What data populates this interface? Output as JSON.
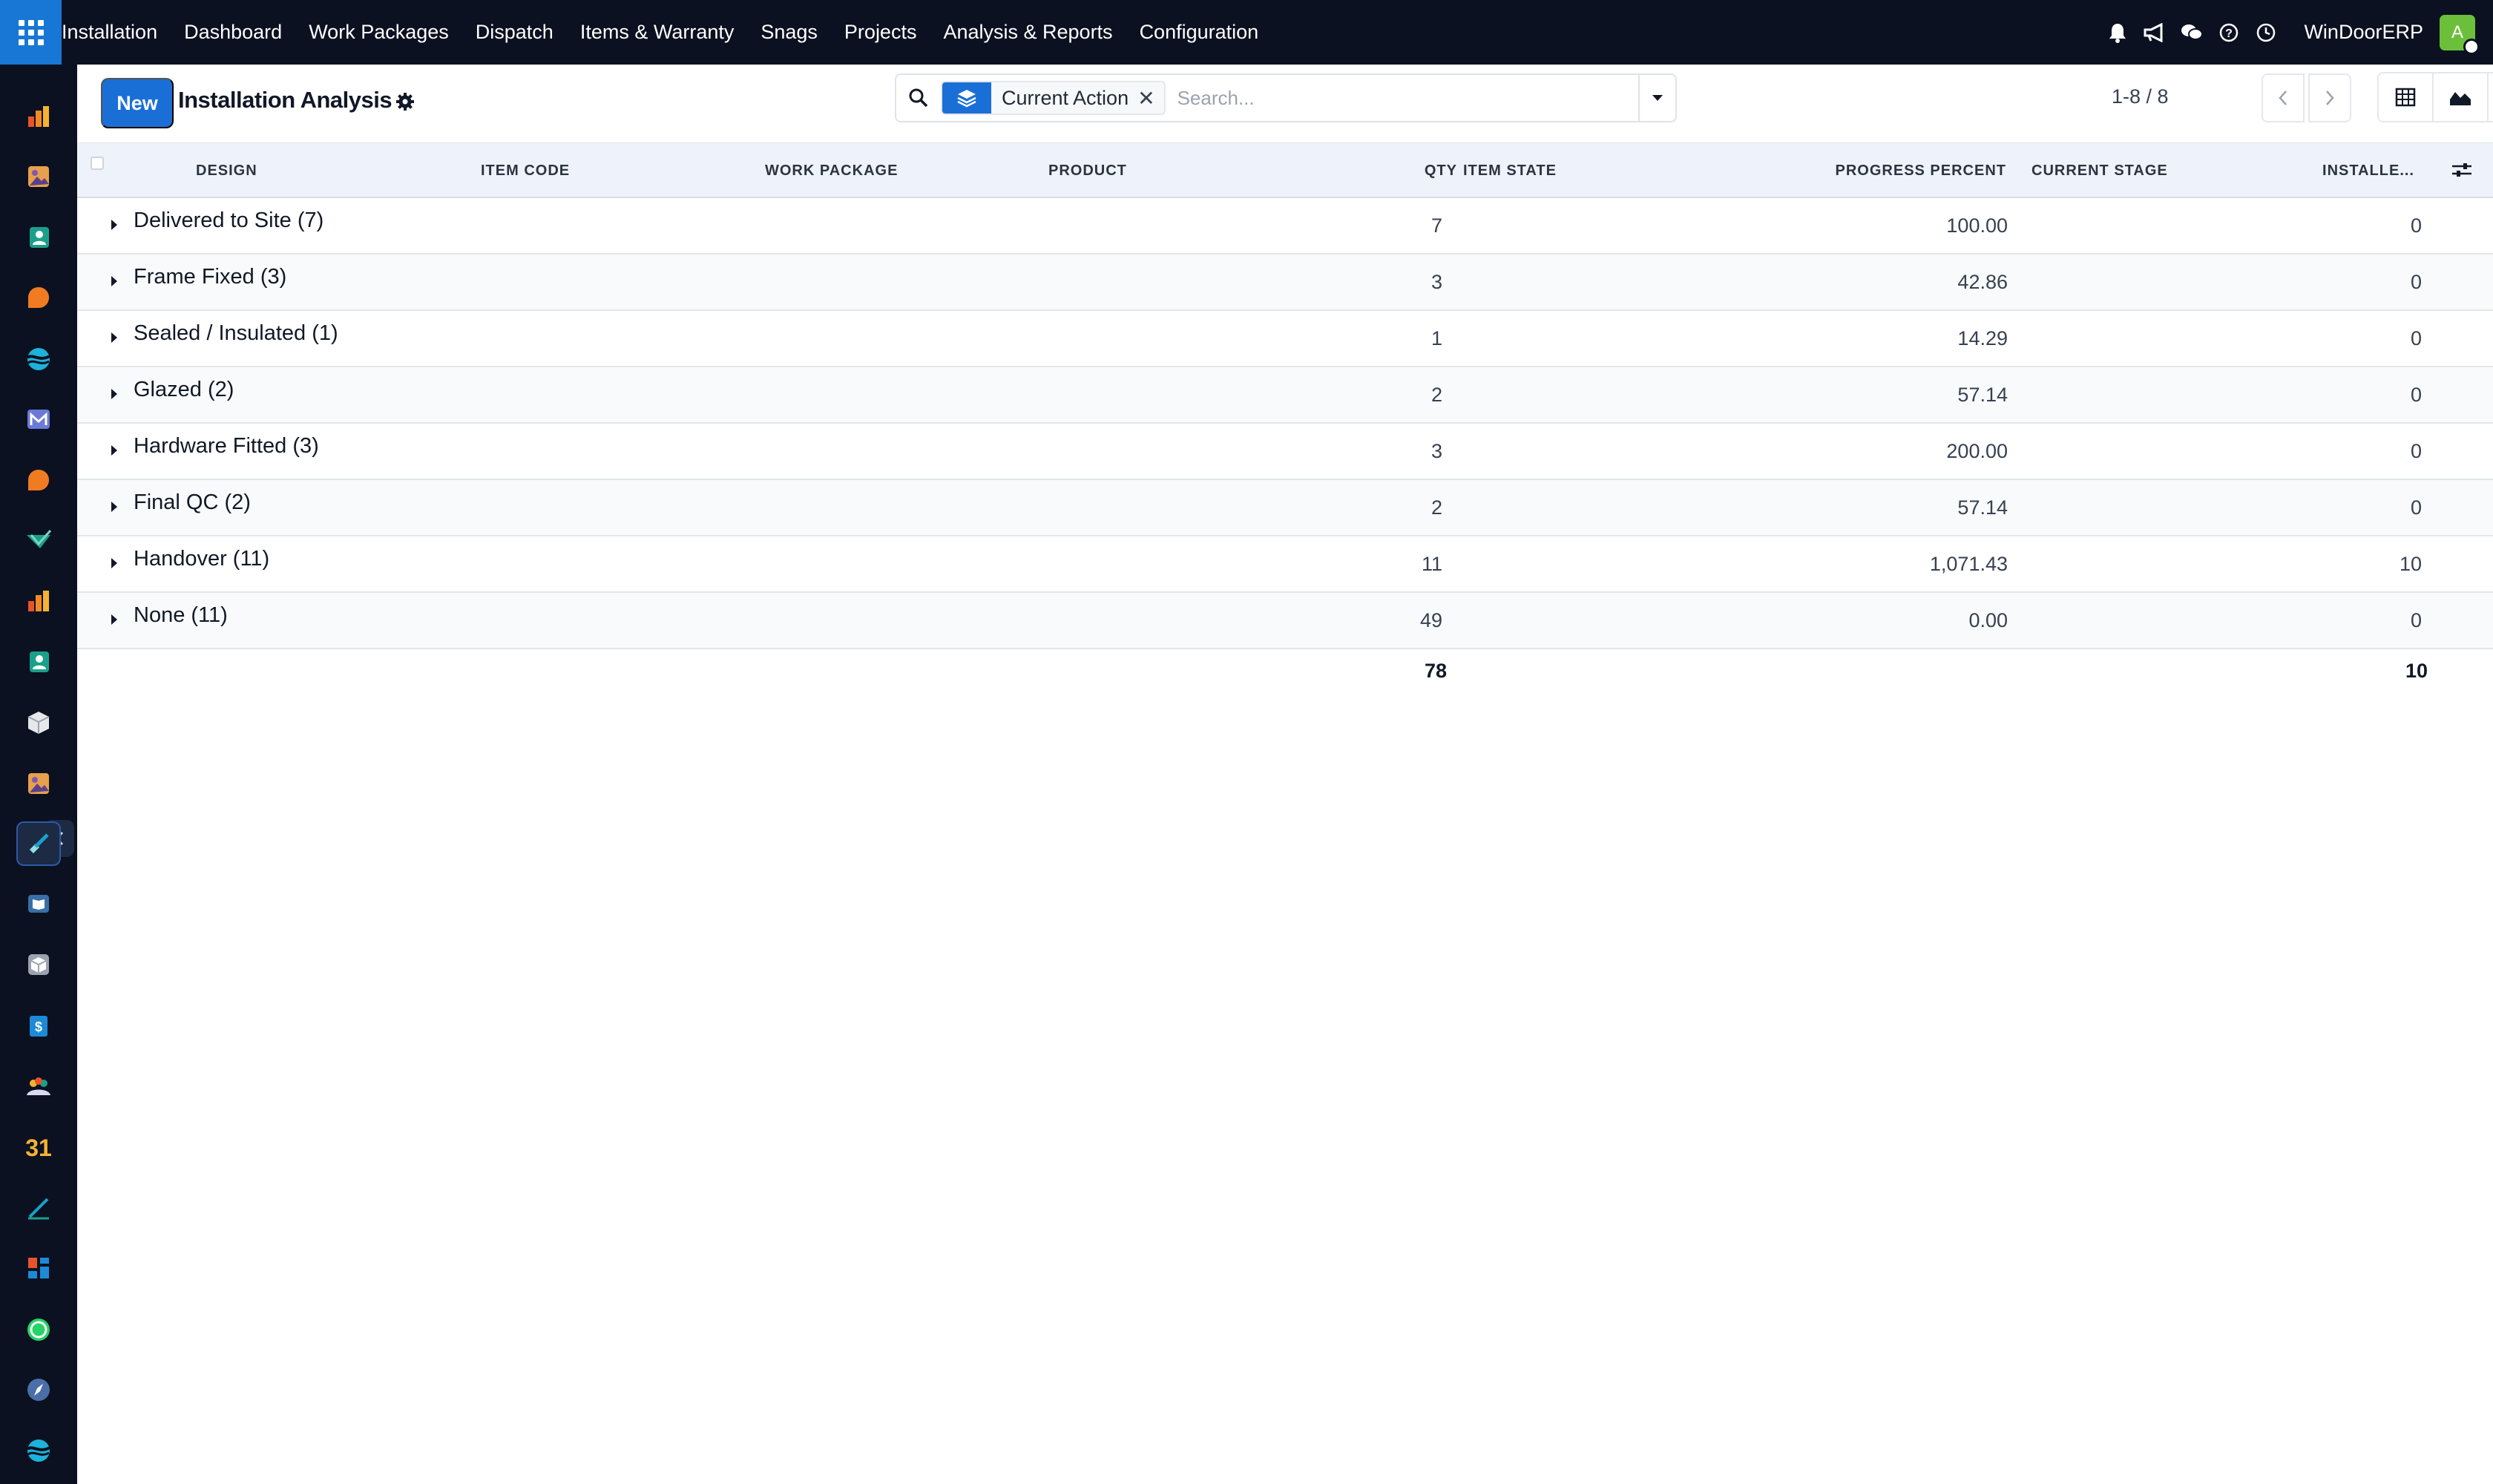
{
  "topbar": {
    "menu": [
      "Installation",
      "Dashboard",
      "Work Packages",
      "Dispatch",
      "Items & Warranty",
      "Snags",
      "Projects",
      "Analysis & Reports",
      "Configuration"
    ],
    "icons": [
      "bell-icon",
      "megaphone-icon",
      "chat-icon",
      "help-icon",
      "clock-icon"
    ],
    "brand": "WinDoorERP",
    "avatar_initial": "A"
  },
  "sidebar": {
    "apps": [
      "chart-bar-app-icon",
      "photo-app-icon",
      "contacts-app-icon",
      "chat-bubble-app-icon",
      "wave-app-icon",
      "mail-app-icon",
      "chat-bubble-app-icon",
      "check-app-icon",
      "chart-bar-app-icon",
      "contacts-app-icon",
      "box-app-icon",
      "photo-app-icon",
      "installation-app-icon",
      "book-app-icon",
      "package-app-icon",
      "invoice-app-icon",
      "team-app-icon",
      "calendar-app-icon",
      "sign-app-icon",
      "dashboard-app-icon",
      "whatsapp-app-icon",
      "compass-app-icon",
      "wave-app-icon"
    ],
    "active_index": 12
  },
  "control": {
    "new_label": "New",
    "title": "Installation Analysis",
    "facet_label": "Current Action",
    "search_placeholder": "Search...",
    "pager": "1-8 / 8"
  },
  "table": {
    "columns": [
      "DESIGN",
      "ITEM CODE",
      "WORK PACKAGE",
      "PRODUCT",
      "QTY",
      "ITEM STATE",
      "PROGRESS PERCENT",
      "CURRENT STAGE",
      "INSTALLE..."
    ],
    "groups": [
      {
        "label": "Delivered to Site (7)",
        "qty": "7",
        "progress": "100.00",
        "installed": "0"
      },
      {
        "label": "Frame Fixed (3)",
        "qty": "3",
        "progress": "42.86",
        "installed": "0"
      },
      {
        "label": "Sealed / Insulated (1)",
        "qty": "1",
        "progress": "14.29",
        "installed": "0"
      },
      {
        "label": "Glazed (2)",
        "qty": "2",
        "progress": "57.14",
        "installed": "0"
      },
      {
        "label": "Hardware Fitted (3)",
        "qty": "3",
        "progress": "200.00",
        "installed": "0"
      },
      {
        "label": "Final QC (2)",
        "qty": "2",
        "progress": "57.14",
        "installed": "0"
      },
      {
        "label": "Handover (11)",
        "qty": "11",
        "progress": "1,071.43",
        "installed": "10"
      },
      {
        "label": "None (11)",
        "qty": "49",
        "progress": "0.00",
        "installed": "0"
      }
    ],
    "totals": {
      "qty": "78",
      "installed": "10"
    }
  },
  "colors": {
    "navbar": "#0b1120",
    "accent": "#1a6fd6",
    "header_bg": "#eef3fb",
    "avatar": "#6cbf3b"
  }
}
